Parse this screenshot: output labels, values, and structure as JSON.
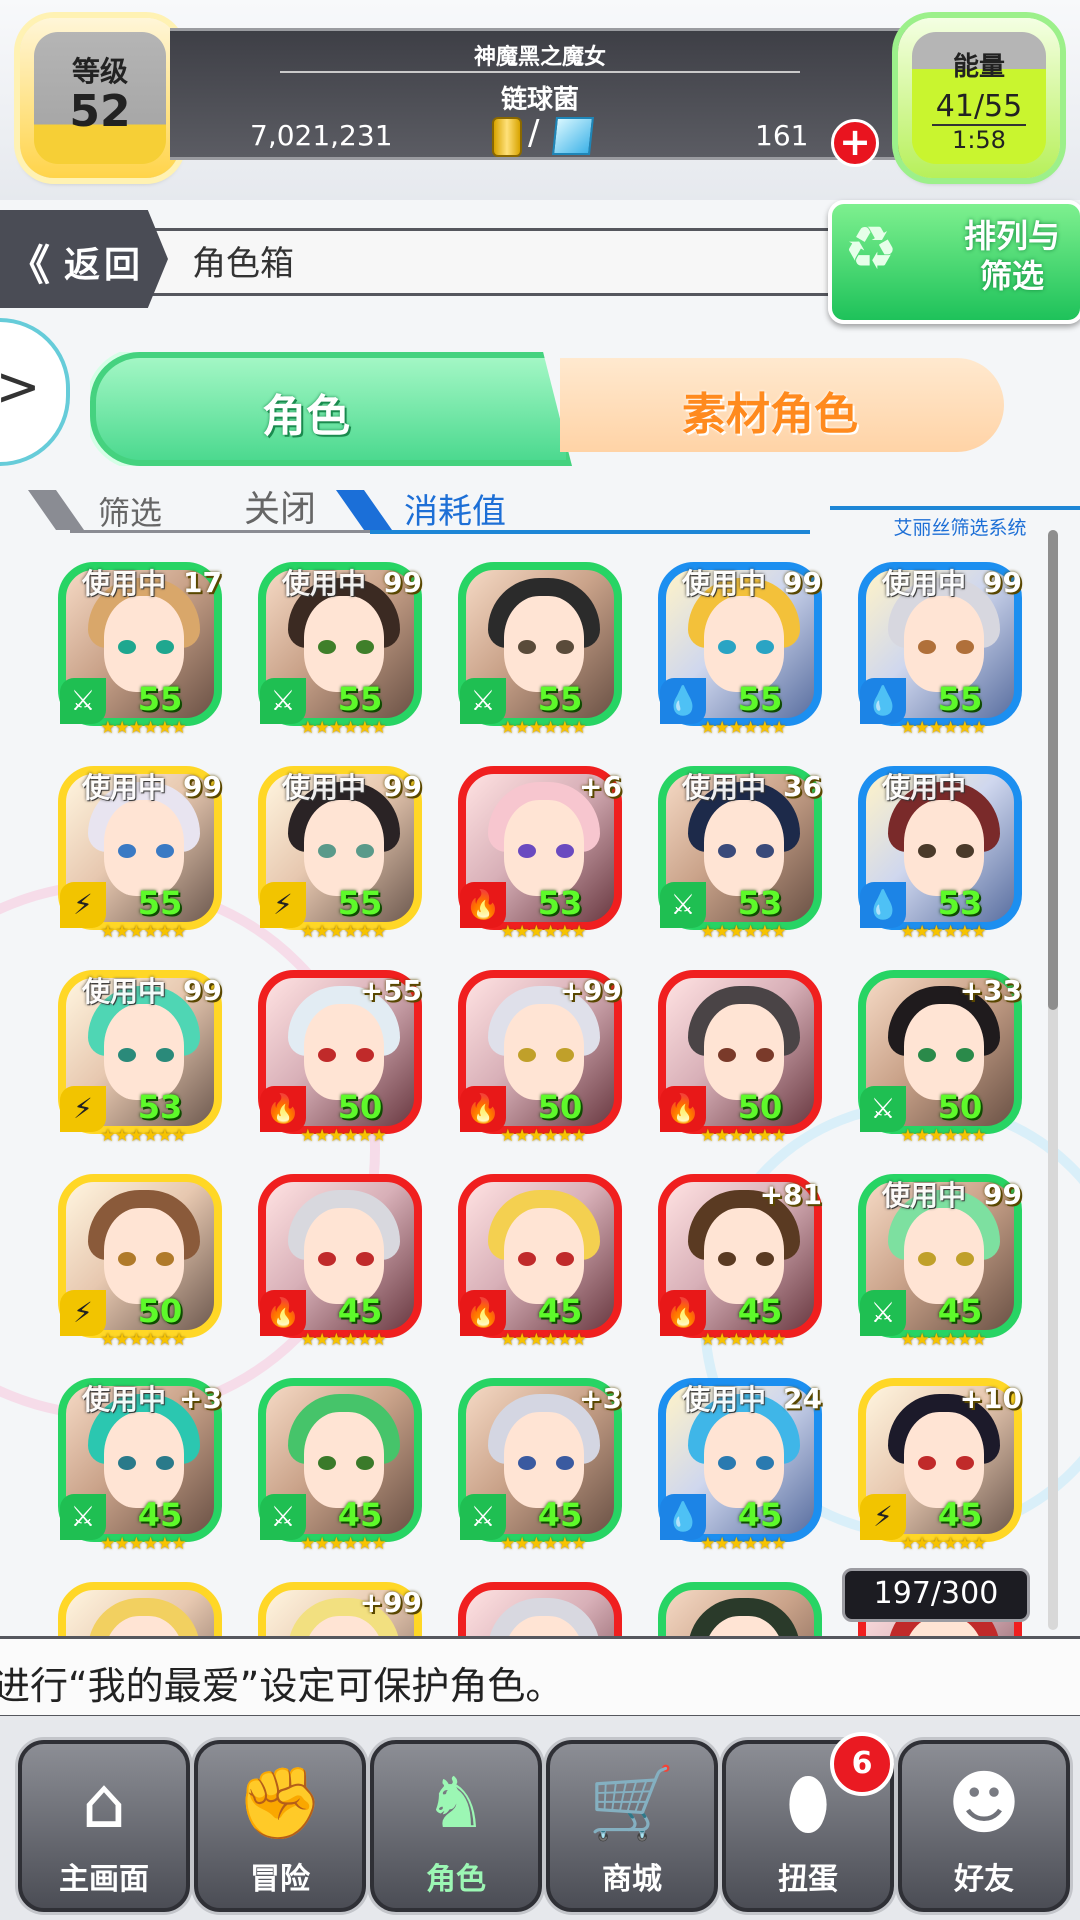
{
  "player": {
    "level_label": "等级",
    "level": "52",
    "title": "神魔黑之魔女",
    "name": "链球菌",
    "money": "7,021,231",
    "slash": "/",
    "gems": "161",
    "add_label": "+",
    "energy_label": "能量",
    "energy": "41/55",
    "energy_timer": "1:58"
  },
  "header": {
    "back_chevrons": "《",
    "back_label": "返回",
    "title": "角色箱",
    "sort_filter_label": "排列与筛选",
    "sort_filter_icon": "bunny-arrows-icon"
  },
  "tabs": {
    "characters": "角色",
    "material": "素材角色",
    "side_arrow": ">"
  },
  "filter": {
    "label": "筛选",
    "value": "关闭",
    "sort_key": "消耗值",
    "system_tag": "艾丽丝筛选系统"
  },
  "grid": {
    "cards": [
      {
        "color": "green",
        "tag": "使用中",
        "plus": "17",
        "elem": "wind",
        "level": "55",
        "hair": "#d9a76a",
        "eye": "#1fa78f"
      },
      {
        "color": "green",
        "tag": "使用中",
        "plus": "99",
        "elem": "wind",
        "level": "55",
        "hair": "#3b2a22",
        "eye": "#3f7f2a"
      },
      {
        "color": "green",
        "tag": "",
        "plus": "",
        "elem": "wind",
        "level": "55",
        "hair": "#2b2b2b",
        "eye": "#5a4b3a"
      },
      {
        "color": "blue",
        "tag": "使用中",
        "plus": "99",
        "elem": "water",
        "level": "55",
        "hair": "#f3c13a",
        "eye": "#2aa4c4"
      },
      {
        "color": "blue",
        "tag": "使用中",
        "plus": "99",
        "elem": "water",
        "level": "55",
        "hair": "#d7d7df",
        "eye": "#b0703a"
      },
      {
        "color": "yellow",
        "tag": "使用中",
        "plus": "99",
        "elem": "thunder",
        "level": "55",
        "hair": "#e8e4f0",
        "eye": "#3a7ac4"
      },
      {
        "color": "yellow",
        "tag": "使用中",
        "plus": "99",
        "elem": "thunder",
        "level": "55",
        "hair": "#2a2325",
        "eye": "#5a9a8a"
      },
      {
        "color": "red",
        "tag": "",
        "plus": "+6",
        "elem": "fire",
        "level": "53",
        "hair": "#f7c6cf",
        "eye": "#6a4ac0"
      },
      {
        "color": "green",
        "tag": "使用中",
        "plus": "36",
        "elem": "wind",
        "level": "53",
        "hair": "#1d2a4a",
        "eye": "#3a4a7a"
      },
      {
        "color": "blue",
        "tag": "使用中",
        "plus": "",
        "elem": "water",
        "level": "53",
        "hair": "#7a2a2a",
        "eye": "#4a3a2a"
      },
      {
        "color": "yellow",
        "tag": "使用中",
        "plus": "99",
        "elem": "thunder",
        "level": "53",
        "hair": "#4fd6b4",
        "eye": "#2a8a7a"
      },
      {
        "color": "red",
        "tag": "",
        "plus": "+55",
        "elem": "fire",
        "level": "50",
        "hair": "#e2ecf3",
        "eye": "#c02a2a"
      },
      {
        "color": "red",
        "tag": "",
        "plus": "+99",
        "elem": "fire",
        "level": "50",
        "hair": "#dfe0ea",
        "eye": "#c0a02a"
      },
      {
        "color": "red",
        "tag": "",
        "plus": "",
        "elem": "fire",
        "level": "50",
        "hair": "#4a4446",
        "eye": "#7a3a2a"
      },
      {
        "color": "green",
        "tag": "",
        "plus": "+33",
        "elem": "wind",
        "level": "50",
        "hair": "#1f1b1d",
        "eye": "#2a8a4a"
      },
      {
        "color": "yellow",
        "tag": "",
        "plus": "",
        "elem": "thunder",
        "level": "50",
        "hair": "#8a5a3a",
        "eye": "#b07a2a"
      },
      {
        "color": "red",
        "tag": "",
        "plus": "",
        "elem": "fire",
        "level": "45",
        "hair": "#d8d8de",
        "eye": "#c02a2a"
      },
      {
        "color": "red",
        "tag": "",
        "plus": "",
        "elem": "fire",
        "level": "45",
        "hair": "#f4d050",
        "eye": "#c02a2a"
      },
      {
        "color": "red",
        "tag": "",
        "plus": "+81",
        "elem": "fire",
        "level": "45",
        "hair": "#5a3a22",
        "eye": "#5a3a22"
      },
      {
        "color": "green",
        "tag": "使用中",
        "plus": "99",
        "elem": "wind",
        "level": "45",
        "hair": "#7de0a0",
        "eye": "#c0a02a"
      },
      {
        "color": "green",
        "tag": "使用中",
        "plus": "+3",
        "elem": "wind",
        "level": "45",
        "hair": "#2bc7b0",
        "eye": "#2a7a8a"
      },
      {
        "color": "green",
        "tag": "",
        "plus": "",
        "elem": "wind",
        "level": "45",
        "hair": "#46c46a",
        "eye": "#3a7a2a"
      },
      {
        "color": "green",
        "tag": "",
        "plus": "+3",
        "elem": "wind",
        "level": "45",
        "hair": "#d4d6e2",
        "eye": "#3a5aa0"
      },
      {
        "color": "blue",
        "tag": "使用中",
        "plus": "24",
        "elem": "water",
        "level": "45",
        "hair": "#3fb6e8",
        "eye": "#2a7ab0"
      },
      {
        "color": "yellow",
        "tag": "",
        "plus": "+10",
        "elem": "thunder",
        "level": "45",
        "hair": "#1c1a2a",
        "eye": "#c02a2a"
      },
      {
        "color": "yellow",
        "tag": "",
        "plus": "",
        "elem": "thunder",
        "level": "",
        "hair": "#f2d060",
        "eye": "#b07a2a"
      },
      {
        "color": "yellow",
        "tag": "",
        "plus": "+99",
        "elem": "thunder",
        "level": "",
        "hair": "#f2e080",
        "eye": "#b07a2a"
      },
      {
        "color": "red",
        "tag": "",
        "plus": "",
        "elem": "fire",
        "level": "",
        "hair": "#d8d8e0",
        "eye": "#c02a2a"
      },
      {
        "color": "green",
        "tag": "",
        "plus": "",
        "elem": "wind",
        "level": "",
        "hair": "#2a3a2a",
        "eye": "#3a7a2a"
      },
      {
        "color": "red",
        "tag": "",
        "plus": "",
        "elem": "fire",
        "level": "",
        "hair": "#c02a2a",
        "eye": "#c02a2a"
      }
    ],
    "stars": "★★★★★★",
    "capacity": "197/300"
  },
  "tip": "进行“我的最爱”设定可保护角色。",
  "nav": {
    "items": [
      {
        "label": "主画面",
        "icon": "home-icon",
        "glyph": "⌂"
      },
      {
        "label": "冒险",
        "icon": "handshake-icon",
        "glyph": "✊"
      },
      {
        "label": "角色",
        "icon": "bunny-icon",
        "glyph": "♞"
      },
      {
        "label": "商城",
        "icon": "cart-icon",
        "glyph": "🛒"
      },
      {
        "label": "扭蛋",
        "icon": "egg-icon",
        "glyph": "⬮"
      },
      {
        "label": "好友",
        "icon": "friends-icon",
        "glyph": "☻"
      }
    ],
    "active_index": 2,
    "badge": "6"
  },
  "colors": {
    "green": "#27d464",
    "blue": "#1c8ff0",
    "red": "#f01f1f",
    "yellow": "#ffd726",
    "accent": "#1d86d6"
  }
}
